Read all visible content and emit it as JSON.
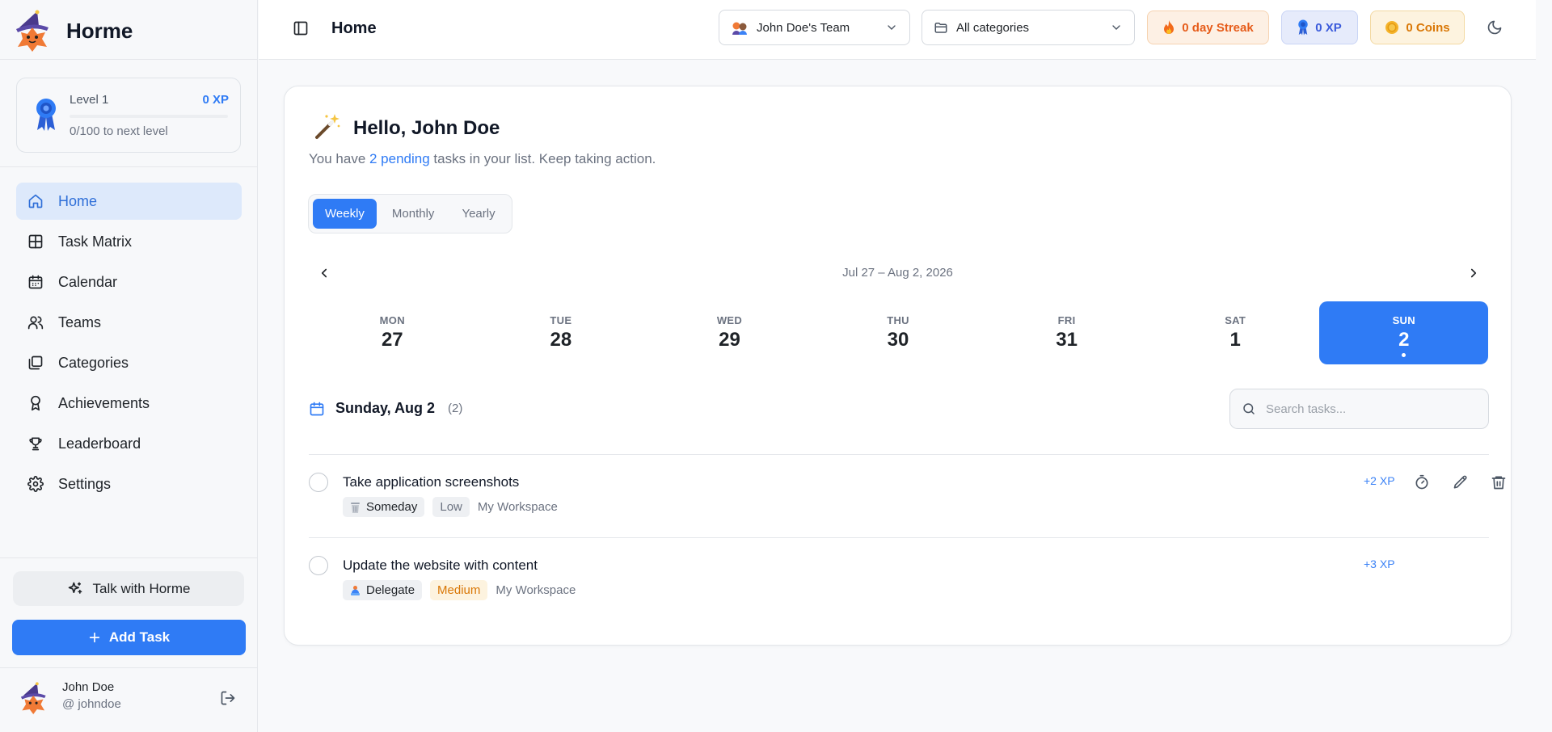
{
  "app": {
    "name": "Horme"
  },
  "sidebar": {
    "level": {
      "label": "Level 1",
      "xp": "0 XP",
      "next": "0/100 to next level",
      "progress": 0
    },
    "nav": [
      {
        "label": "Home",
        "icon": "home-icon",
        "active": true
      },
      {
        "label": "Task Matrix",
        "icon": "grid-icon"
      },
      {
        "label": "Calendar",
        "icon": "calendar-icon"
      },
      {
        "label": "Teams",
        "icon": "users-icon"
      },
      {
        "label": "Categories",
        "icon": "folders-icon"
      },
      {
        "label": "Achievements",
        "icon": "award-icon"
      },
      {
        "label": "Leaderboard",
        "icon": "trophy-icon"
      },
      {
        "label": "Settings",
        "icon": "gear-icon"
      }
    ],
    "talk_label": "Talk with Horme",
    "add_task_label": "Add Task",
    "user": {
      "name": "John Doe",
      "handle": "@ johndoe"
    }
  },
  "topbar": {
    "title": "Home",
    "team_select": "John Doe's Team",
    "category_select": "All categories",
    "streak": "0 day Streak",
    "xp": "0 XP",
    "coins": "0 Coins"
  },
  "main": {
    "greeting": "Hello, John Doe",
    "subtitle_pre": "You have ",
    "subtitle_highlight": "2 pending",
    "subtitle_post": " tasks in your list. Keep taking action.",
    "tabs": [
      {
        "label": "Weekly",
        "active": true
      },
      {
        "label": "Monthly"
      },
      {
        "label": "Yearly"
      }
    ],
    "week_range": "Jul 27 – Aug 2, 2026",
    "days": [
      {
        "name": "MON",
        "num": "27"
      },
      {
        "name": "TUE",
        "num": "28"
      },
      {
        "name": "WED",
        "num": "29"
      },
      {
        "name": "THU",
        "num": "30"
      },
      {
        "name": "FRI",
        "num": "31"
      },
      {
        "name": "SAT",
        "num": "1"
      },
      {
        "name": "SUN",
        "num": "2",
        "active": true,
        "has_tasks": true
      }
    ],
    "selected_date": "Sunday, Aug 2",
    "selected_count": "(2)",
    "search_placeholder": "Search tasks...",
    "tasks": [
      {
        "title": "Take application screenshots",
        "quadrant": "Someday",
        "priority": "Low",
        "workspace": "My Workspace",
        "xp": "+2 XP"
      },
      {
        "title": "Update the website with content",
        "quadrant": "Delegate",
        "priority": "Medium",
        "workspace": "My Workspace",
        "xp": "+3 XP"
      }
    ]
  },
  "colors": {
    "accent": "#2f7bf5",
    "active_nav_bg": "#dde9fb",
    "streak": "#e65c1a",
    "coins": "#d97706",
    "xp": "#3b5bdb"
  }
}
